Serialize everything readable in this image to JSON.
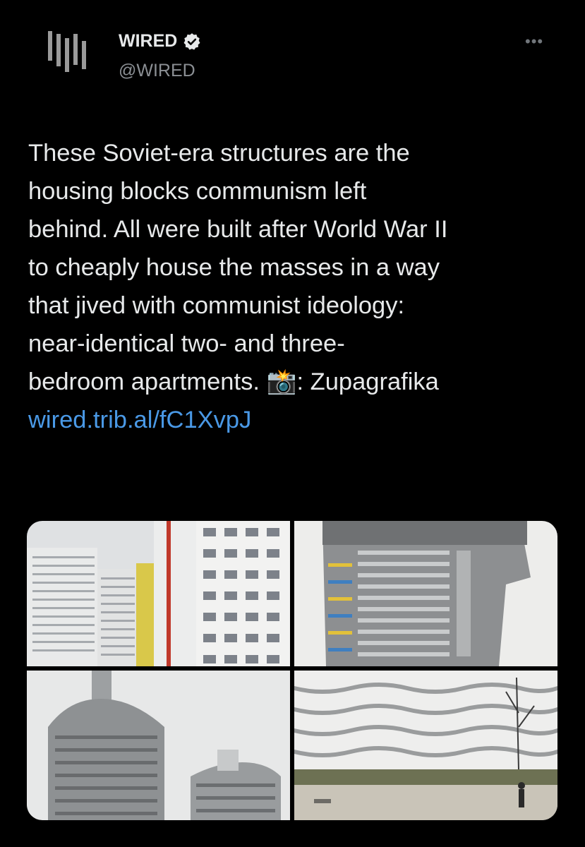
{
  "account": {
    "name": "WIRED",
    "handle": "@WIRED",
    "verified": true,
    "avatar_icon": "wired-logo-icon",
    "more_icon": "more-options-icon"
  },
  "tweet": {
    "lines": [
      "These Soviet-era structures are the",
      "housing blocks communism left",
      "behind. All were built after World War II",
      "to cheaply house the masses in a way",
      "that jived with communist ideology:",
      "near-identical two- and three-",
      "bedroom apartments. 📸: Zupagrafika"
    ],
    "link": "wired.trib.al/fC1XvpJ"
  },
  "media": {
    "count": 4,
    "photos": [
      {
        "subject": "white-high-rise-blocks-with-colored-stripes"
      },
      {
        "subject": "gray-block-with-cantilevered-top"
      },
      {
        "subject": "round-concrete-towers"
      },
      {
        "subject": "curved-balcony-block-with-pedestrian"
      }
    ]
  },
  "colors": {
    "background": "#000000",
    "text": "#e7e9ea",
    "secondary": "#8b8f94",
    "link": "#4a99e6"
  }
}
